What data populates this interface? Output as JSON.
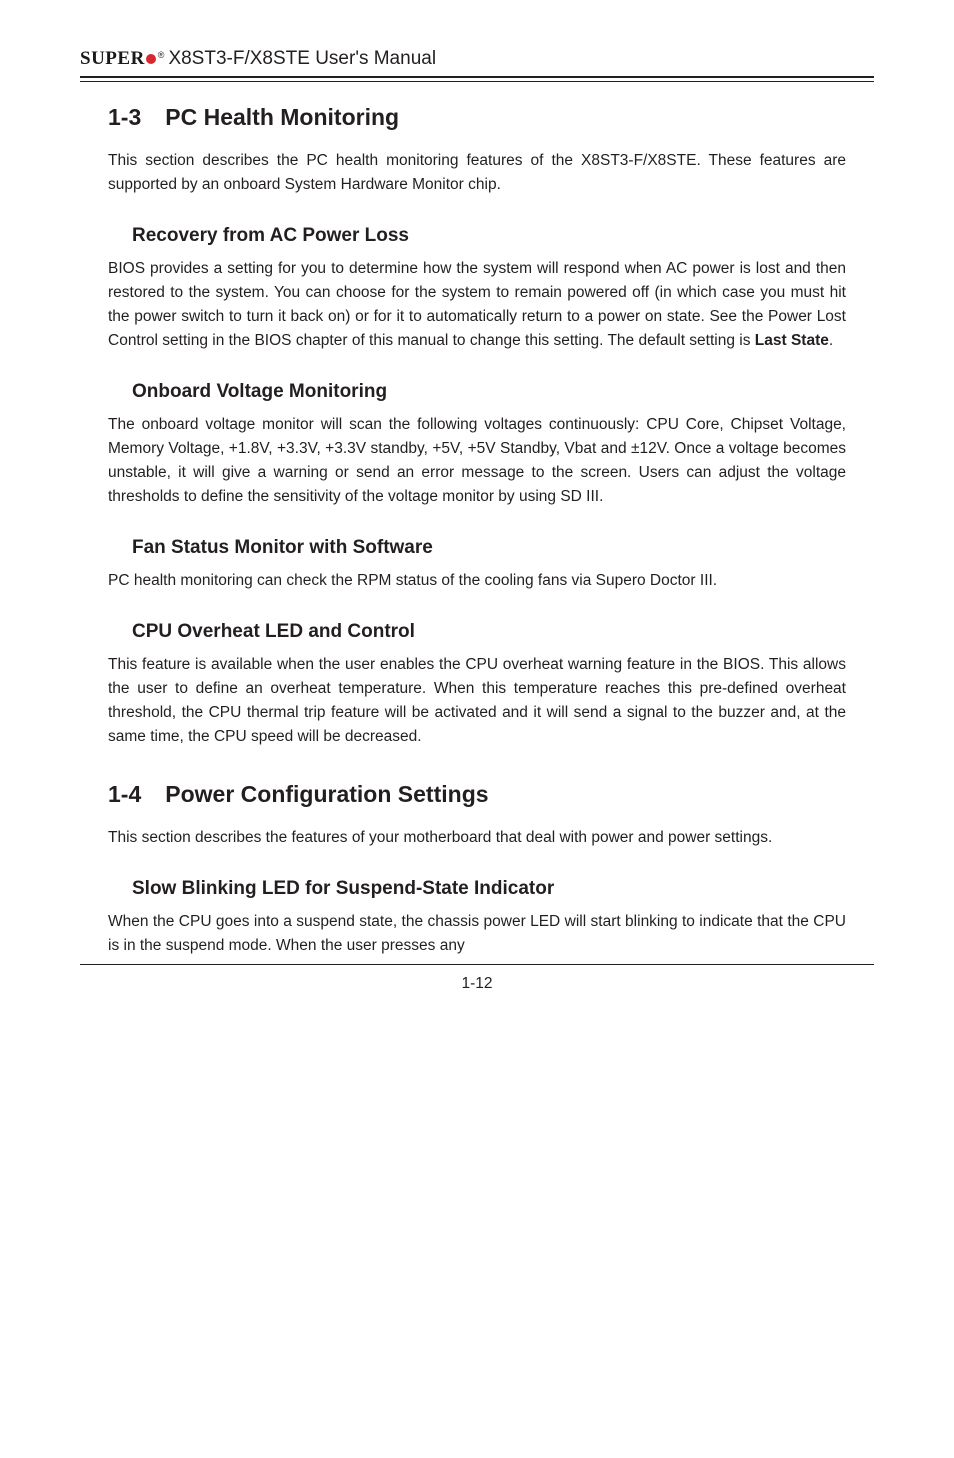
{
  "header": {
    "brand_left": "SUPER",
    "brand_reg": "®",
    "manual_title": "X8ST3-F/X8STE User's Manual"
  },
  "sections": {
    "s1_3": {
      "number": "1-3",
      "title": "PC Health Monitoring",
      "intro": "This section describes the PC health monitoring features of the X8ST3-F/X8STE. These features are supported by an onboard System Hardware Monitor chip.",
      "recovery": {
        "heading": "Recovery from AC Power Loss",
        "body_before_bold": "BIOS provides a setting for you to determine how the system will respond when AC power is lost and then restored to the system. You can choose for the system to remain powered off (in which case you must hit the power switch to turn it back on) or for it to automatically return to a power on state. See the Power Lost Control setting in the BIOS chapter of this manual to change this setting. The default setting is ",
        "body_bold": "Last State",
        "body_after_bold": "."
      },
      "voltage": {
        "heading": "Onboard Voltage Monitoring",
        "body": "The onboard voltage monitor will scan the following voltages continuously: CPU Core, Chipset Voltage, Memory Voltage, +1.8V, +3.3V, +3.3V standby, +5V, +5V Standby, Vbat and ±12V. Once a voltage becomes unstable, it will give a warning or send an error message to the screen.  Users can adjust the voltage thresholds to define the sensitivity of the voltage monitor by using SD III."
      },
      "fan": {
        "heading": "Fan Status Monitor with Software",
        "body": "PC health monitoring can check the RPM status of the cooling fans via Supero Doctor III."
      },
      "cpu": {
        "heading": "CPU Overheat LED and Control",
        "body": "This feature is available when the  user enables the CPU overheat warning feature in the BIOS. This allows the user to define an overheat temperature. When this temperature reaches this pre-defined overheat threshold, the CPU thermal trip feature will be activated and it will send a signal to the buzzer and, at the same time, the CPU speed will be decreased."
      }
    },
    "s1_4": {
      "number": "1-4",
      "title": "Power Configuration Settings",
      "intro": "This section describes the features of your motherboard that deal with power and power settings.",
      "slow_blink": {
        "heading": "Slow Blinking LED for Suspend-State Indicator",
        "body": "When the CPU goes into a suspend state, the chassis power LED will start blinking to indicate that the CPU is in the suspend mode. When the user presses any"
      }
    }
  },
  "footer": {
    "page_number": "1-12"
  }
}
